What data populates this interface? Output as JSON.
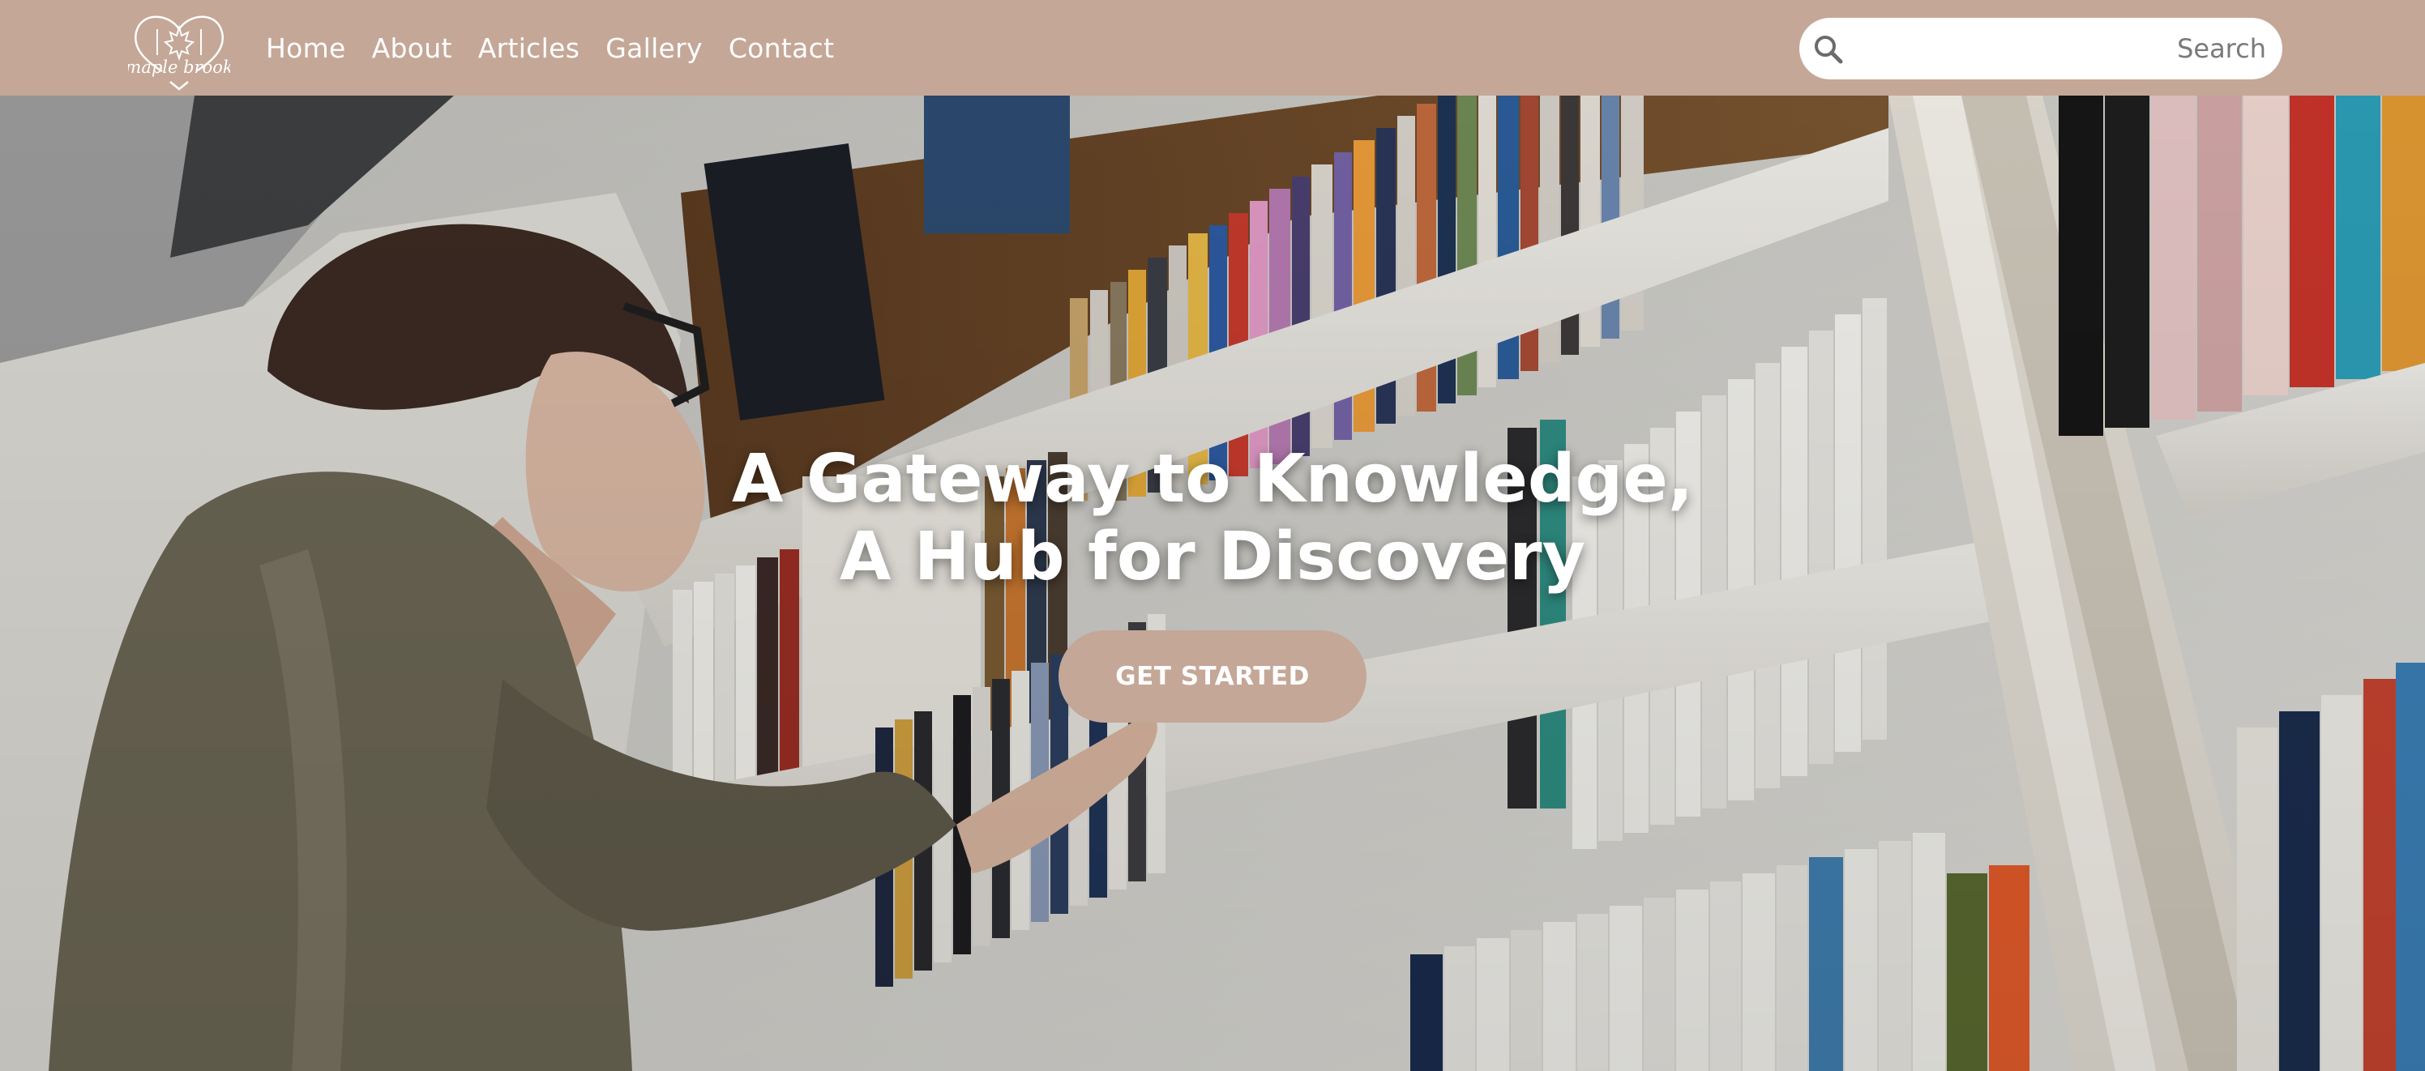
{
  "brand": {
    "logo_text": "maple brook"
  },
  "nav": {
    "items": [
      {
        "label": "Home"
      },
      {
        "label": "About"
      },
      {
        "label": "Articles"
      },
      {
        "label": "Gallery"
      },
      {
        "label": "Contact"
      }
    ]
  },
  "search": {
    "placeholder": "Search",
    "value": ""
  },
  "hero": {
    "title_line1": "A Gateway to Knowledge,",
    "title_line2": "A Hub for Discovery",
    "cta_label": "GET STARTED"
  },
  "colors": {
    "nav_bg": "#c4a797",
    "cta_bg": "#c4a797",
    "text_light": "#ffffff"
  }
}
